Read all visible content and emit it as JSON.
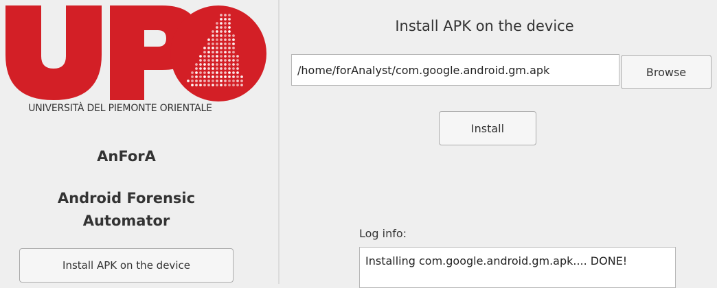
{
  "sidebar": {
    "logo_text": "UPO",
    "university": "UNIVERSITÀ DEL PIEMONTE ORIENTALE",
    "app_name": "AnForA",
    "app_full_line1": "Android Forensic",
    "app_full_line2": "Automator",
    "nav_button": "Install APK on the device"
  },
  "main": {
    "title": "Install APK on the device",
    "path_value": "/home/forAnalyst/com.google.android.gm.apk",
    "browse_label": "Browse",
    "install_label": "Install",
    "log_label": "Log info:",
    "log_text": "Installing com.google.android.gm.apk.... DONE!"
  },
  "colors": {
    "brand_red": "#d31f26",
    "background": "#efefef"
  }
}
